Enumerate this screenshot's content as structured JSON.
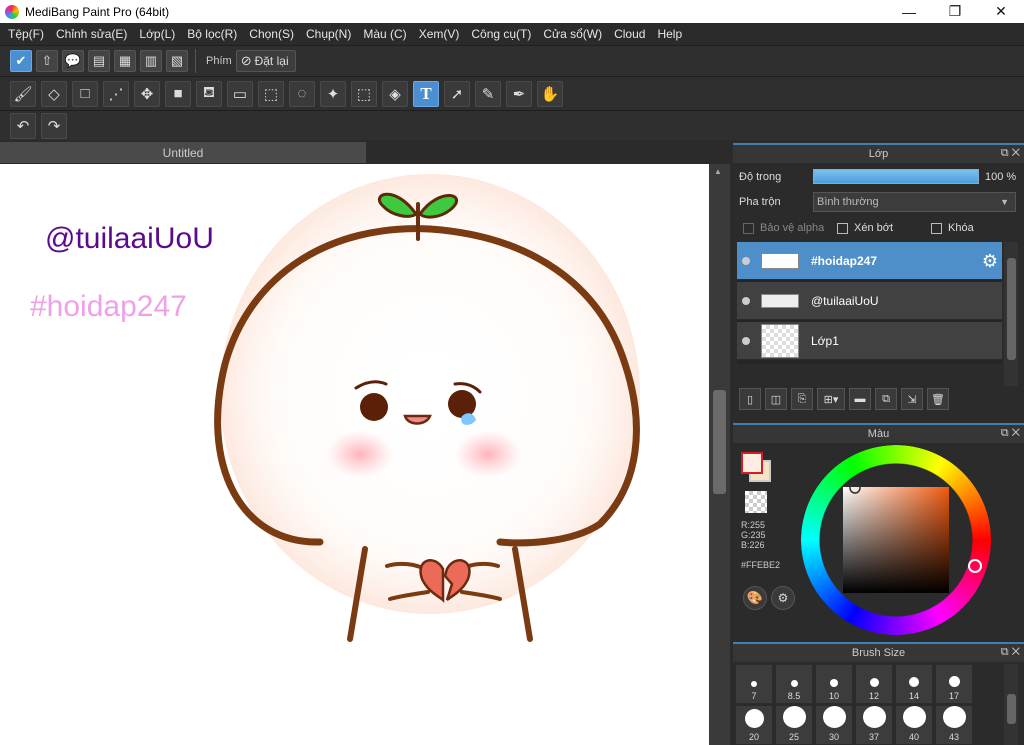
{
  "window": {
    "title": "MediBang Paint Pro (64bit)",
    "minimize": "—",
    "maximize": "❐",
    "close": "✕"
  },
  "menu": [
    "Tệp(F)",
    "Chỉnh sửa(E)",
    "Lớp(L)",
    "Bộ lọc(R)",
    "Chọn(S)",
    "Chụp(N)",
    "Màu (C)",
    "Xem(V)",
    "Công cụ(T)",
    "Cửa sổ(W)",
    "Cloud",
    "Help"
  ],
  "toolbar1": {
    "shortcut_label": "Phím",
    "reset_label": "Đặt lại"
  },
  "document": {
    "tab": "Untitled"
  },
  "canvas": {
    "text1": "@tuilaaiUoU",
    "text2": "#hoidap247",
    "text1_color": "#5a0a8a",
    "text2_color": "#f0a0e8"
  },
  "layer_panel": {
    "title": "Lớp",
    "opacity_label": "Độ trong",
    "opacity_value": "100 %",
    "blend_label": "Pha trộn",
    "blend_value": "Bình thường",
    "protect_alpha": "Bảo vệ alpha",
    "clip": "Xén bớt",
    "lock": "Khóa",
    "layers": [
      {
        "name": "#hoidap247",
        "selected": true
      },
      {
        "name": "@tuilaaiUoU",
        "selected": false
      },
      {
        "name": "Lớp1",
        "selected": false
      }
    ]
  },
  "color_panel": {
    "title": "Màu",
    "r": "R:255",
    "g": "G:235",
    "b": "B:226",
    "hex": "#FFEBE2",
    "primary_color": "#FFEBE2",
    "secondary_color": "#f7e3c6"
  },
  "brush_panel": {
    "title": "Brush Size",
    "row1": [
      "7",
      "8.5",
      "10",
      "12",
      "14",
      "17"
    ],
    "row2": [
      "20",
      "25",
      "30",
      "37",
      "40",
      "43"
    ]
  },
  "colors": {
    "accent": "#4f8fc9"
  }
}
